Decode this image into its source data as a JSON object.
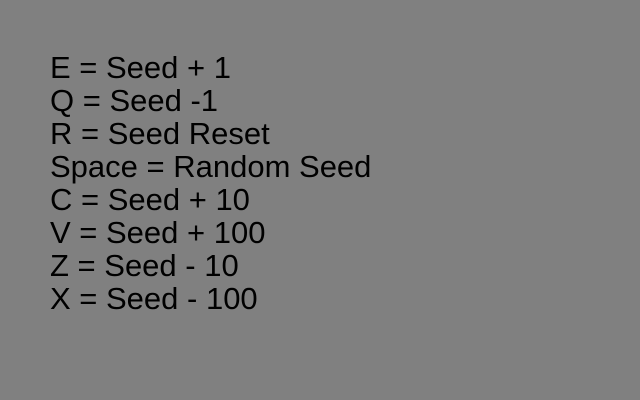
{
  "colors": {
    "background": "#808080",
    "text": "#000000"
  },
  "controls": [
    "E = Seed + 1",
    "Q = Seed -1",
    "R = Seed Reset",
    "Space = Random Seed",
    "C = Seed + 10",
    "V = Seed + 100",
    "Z = Seed - 10",
    "X = Seed - 100"
  ]
}
